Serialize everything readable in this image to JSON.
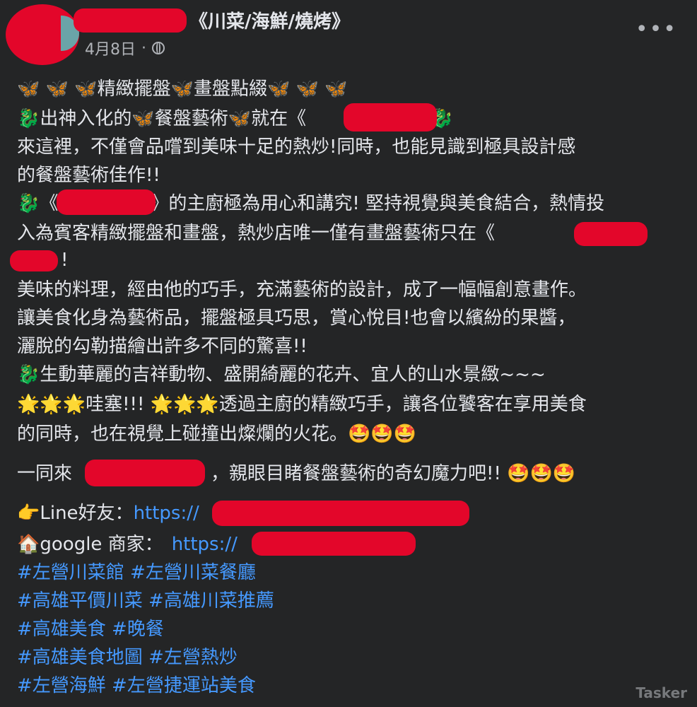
{
  "post": {
    "title": "《川菜/海鮮/燒烤》",
    "date": "4月8日",
    "dot": "·",
    "more_label": "•••"
  },
  "body": {
    "l1": "🦋 🦋 🦋精緻擺盤🦋畫盤點綴🦋 🦋 🦋",
    "l2": "🐉出神入化的🦋餐盤藝術🦋就在《",
    "l2b": "》🐉",
    "l3": "來這裡，不僅會品嚐到美味十足的熱炒!同時，也能見識到極具設計感",
    "l4": "的餐盤藝術佳作!!",
    "l5": "🐉《",
    "l5b": "》的主廚極為用心和講究! 堅持視覺與美食結合，熱情投",
    "l6": "入為賓客精緻擺盤和畫盤，熱炒店唯一僅有畫盤藝術只在《",
    "l7": "!",
    "l8": "美味的料理，經由他的巧手，充滿藝術的設計，成了一幅幅創意畫作。",
    "l9": "讓美食化身為藝術品，擺盤極具巧思，賞心悅目!也會以繽紛的果醬，",
    "l10": "灑脫的勾勒描繪出許多不同的驚喜!!",
    "l11": "🐉生動華麗的吉祥動物、盛開綺麗的花卉、宜人的山水景緻~~~",
    "l12": "🌟🌟🌟哇塞!!! 🌟🌟🌟透過主廚的精緻巧手，讓各位饕客在享用美食",
    "l13": "的同時，也在視覺上碰撞出燦爛的火花。🤩🤩🤩",
    "l14a": "一同來",
    "l14b": "，親眼目睹餐盤藝術的奇幻魔力吧!! 🤩🤩🤩",
    "line_label": "👉Line好友：",
    "line_url": "https://",
    "google_label": "🏠google 商家：",
    "google_url": "https://"
  },
  "hashtags": [
    "#左營川菜館 #左營川菜餐廳",
    "#高雄平價川菜 #高雄川菜推薦",
    "#高雄美食 #晚餐",
    "#高雄美食地圖 #左營熱炒",
    "#左營海鮮 #左營捷運站美食"
  ],
  "watermark": "Tasker"
}
